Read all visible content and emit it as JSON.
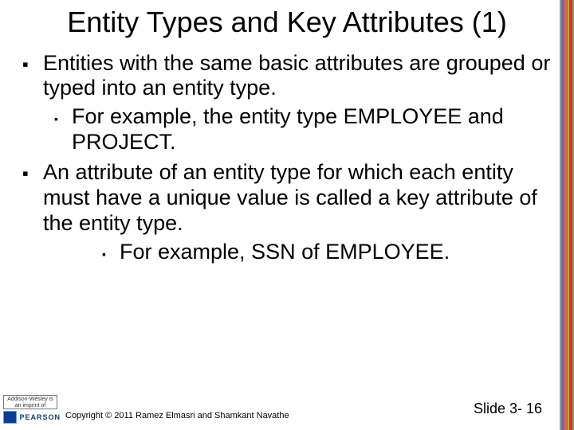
{
  "title": "Entity Types and Key Attributes (1)",
  "bullets": {
    "b1": "Entities with the same basic attributes are grouped or typed into an entity type.",
    "b1a": "For example, the entity type EMPLOYEE and PROJECT.",
    "b2": "An attribute of an entity type for which each entity must have a unique value is called a key attribute of the entity type.",
    "b2a": "For example, SSN of EMPLOYEE."
  },
  "footer": {
    "copyright": "Copyright © 2011 Ramez Elmasri and Shamkant Navathe",
    "slide_number": "Slide 3- 16",
    "logo_top": "Addison-Wesley is an imprint of",
    "logo_brand": "PEARSON"
  }
}
